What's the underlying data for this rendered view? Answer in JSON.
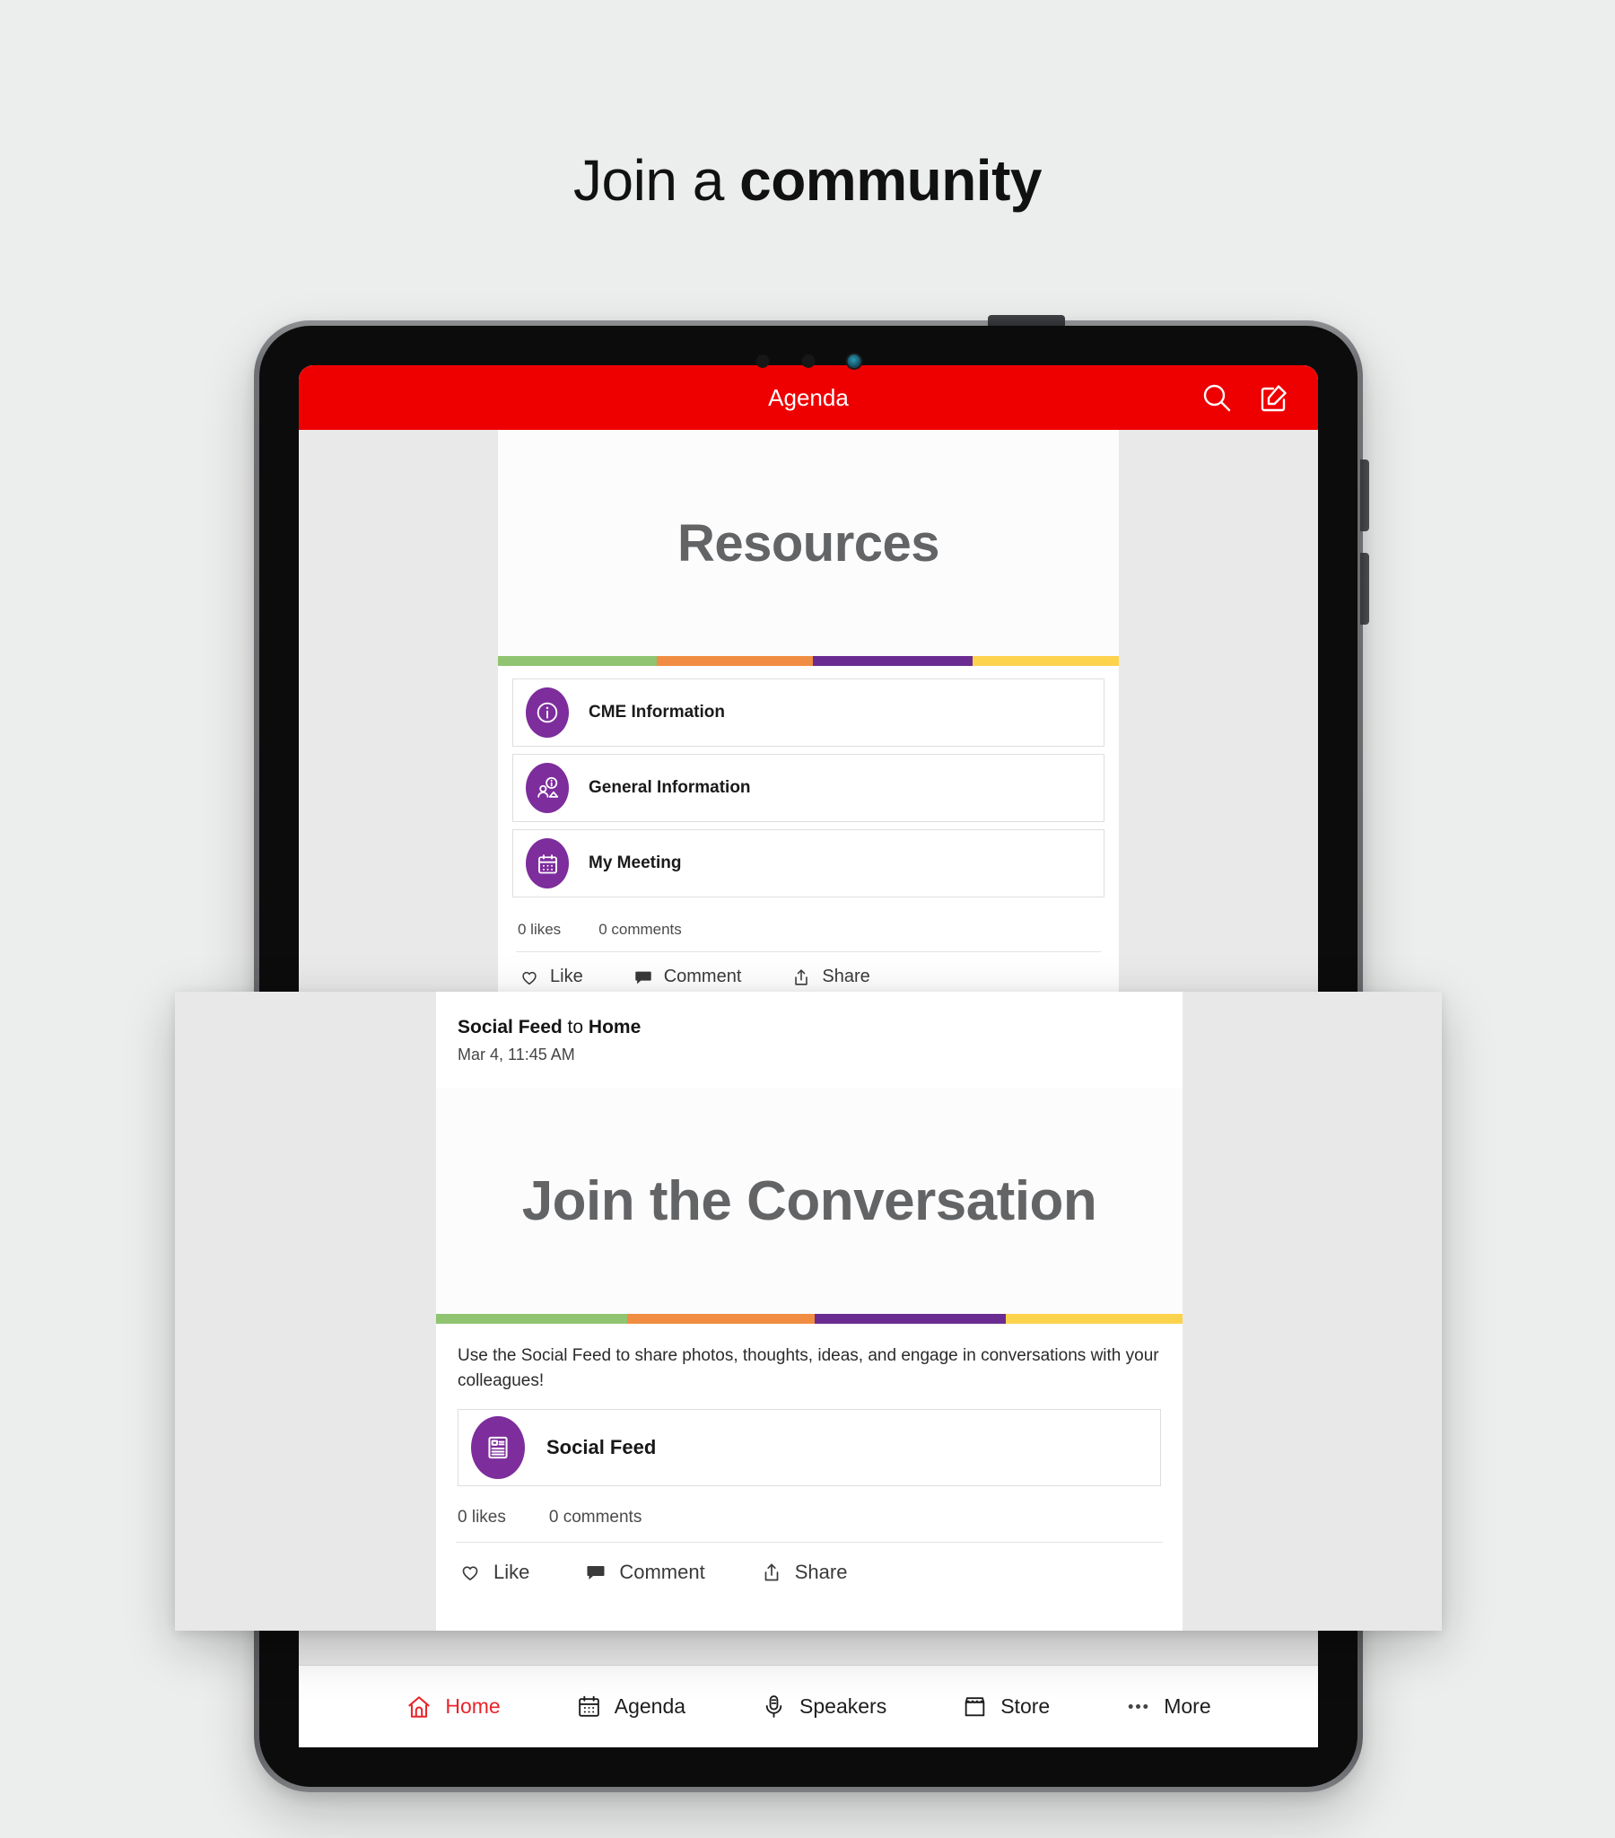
{
  "heading": {
    "prefix": "Join a ",
    "accent": "community"
  },
  "app": {
    "header": {
      "title": "Agenda",
      "search_icon": "search-icon",
      "compose_icon": "compose-icon"
    },
    "feed_post": {
      "hero_title": "Resources",
      "stripe_colors": [
        "#90c471",
        "#f08d42",
        "#6a2c91",
        "#fdd34e"
      ],
      "items": [
        {
          "label": "CME Information",
          "icon": "info-circle-icon"
        },
        {
          "label": "General Information",
          "icon": "person-info-icon"
        },
        {
          "label": "My Meeting",
          "icon": "calendar-icon"
        }
      ],
      "likes": "0 likes",
      "comments": "0 comments",
      "actions": [
        {
          "label": "Like",
          "icon": "heart-icon"
        },
        {
          "label": "Comment",
          "icon": "comment-icon"
        },
        {
          "label": "Share",
          "icon": "share-icon"
        }
      ]
    },
    "bottom_nav": [
      {
        "label": "Home",
        "icon": "home-icon",
        "active": true
      },
      {
        "label": "Agenda",
        "icon": "calendar-icon",
        "active": false
      },
      {
        "label": "Speakers",
        "icon": "microphone-icon",
        "active": false
      },
      {
        "label": "Store",
        "icon": "store-icon",
        "active": false
      },
      {
        "label": "More",
        "icon": "ellipsis-icon",
        "active": false
      }
    ]
  },
  "overlay_post": {
    "author": "Social Feed",
    "preposition": " to ",
    "channel": "Home",
    "timestamp": "Mar 4, 11:45 AM",
    "hero_title": "Join the Conversation",
    "body": "Use the Social Feed to share photos, thoughts, ideas, and engage in conversations with your colleagues!",
    "item": {
      "label": "Social Feed",
      "icon": "article-icon"
    },
    "likes": "0 likes",
    "comments": "0 comments",
    "actions": [
      {
        "label": "Like",
        "icon": "heart-icon"
      },
      {
        "label": "Comment",
        "icon": "comment-icon"
      },
      {
        "label": "Share",
        "icon": "share-icon"
      }
    ]
  },
  "colors": {
    "header_red": "#ef0000",
    "accent_purple": "#7d2d9c",
    "active_nav_red": "#e8242a",
    "page_bg": "#eceded"
  }
}
